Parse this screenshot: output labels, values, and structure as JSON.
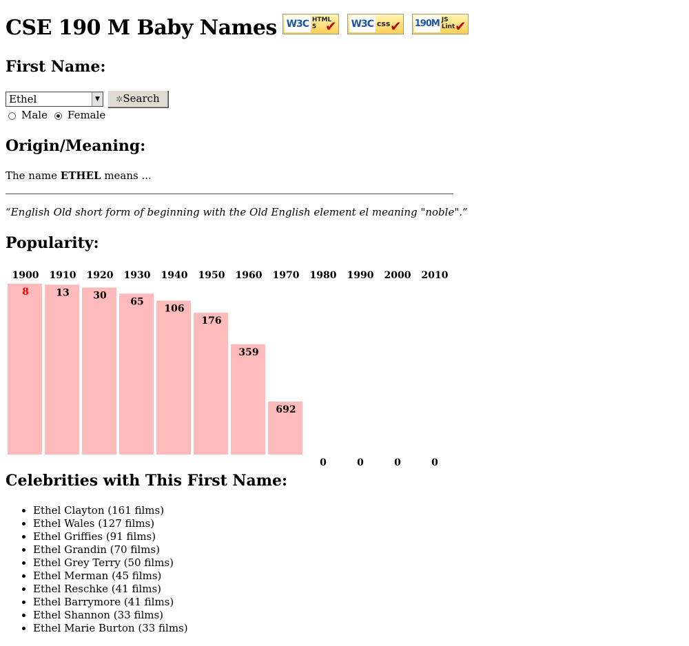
{
  "page": {
    "title": "CSE 190 M Baby Names",
    "badges": [
      {
        "name": "w3c-html5-badge",
        "left": "W3C",
        "right_top": "HTML",
        "right_bottom": "5"
      },
      {
        "name": "w3c-css-badge",
        "left": "W3C",
        "right_top": "css",
        "right_bottom": ""
      },
      {
        "name": "jslint-badge",
        "left": "190M",
        "right_top": "JS",
        "right_bottom": "Lint"
      }
    ]
  },
  "first_name": {
    "heading": "First Name:",
    "selected_name": "Ethel",
    "search_label": "Search",
    "gender_options": [
      {
        "label": "Male",
        "selected": false
      },
      {
        "label": "Female",
        "selected": true
      }
    ]
  },
  "origin": {
    "heading": "Origin/Meaning:",
    "prefix": "The name",
    "name_caps": "ETHEL",
    "suffix": "means ...",
    "meaning": "“English Old short form of beginning with the Old English element el meaning \"noble\".”"
  },
  "popularity": {
    "heading": "Popularity:"
  },
  "chart_data": {
    "type": "bar",
    "categories": [
      "1900",
      "1910",
      "1920",
      "1930",
      "1940",
      "1950",
      "1960",
      "1970",
      "1980",
      "1990",
      "2000",
      "2010"
    ],
    "values": [
      8,
      13,
      30,
      65,
      106,
      176,
      359,
      692,
      0,
      0,
      0,
      0
    ],
    "ylim": [
      0,
      1000
    ],
    "note_top_rank_color": "#ff0000",
    "bar_color": "#ffbbbb"
  },
  "celebrities": {
    "heading": "Celebrities with This First Name:",
    "items": [
      "Ethel Clayton (161 films)",
      "Ethel Wales (127 films)",
      "Ethel Griffies (91 films)",
      "Ethel Grandin (70 films)",
      "Ethel Grey Terry (50 films)",
      "Ethel Merman (45 films)",
      "Ethel Reschke (41 films)",
      "Ethel Barrymore (41 films)",
      "Ethel Shannon (33 films)",
      "Ethel Marie Burton (33 films)"
    ]
  }
}
